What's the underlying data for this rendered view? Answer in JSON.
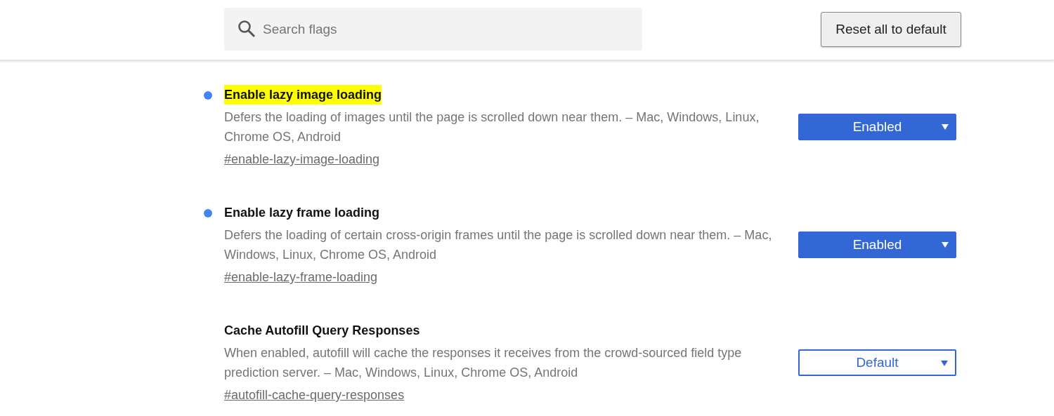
{
  "search": {
    "placeholder": "Search flags"
  },
  "reset_button": "Reset all to default",
  "experiments": [
    {
      "title": "Enable lazy image loading",
      "modified": true,
      "highlighted": true,
      "description": "Defers the loading of images until the page is scrolled down near them. – Mac, Windows, Linux, Chrome OS, Android",
      "link": "#enable-lazy-image-loading",
      "select": {
        "value": "Enabled",
        "kind": "enabled"
      }
    },
    {
      "title": "Enable lazy frame loading",
      "modified": true,
      "highlighted": false,
      "description": "Defers the loading of certain cross-origin frames until the page is scrolled down near them. – Mac, Windows, Linux, Chrome OS, Android",
      "link": "#enable-lazy-frame-loading",
      "select": {
        "value": "Enabled",
        "kind": "enabled"
      }
    },
    {
      "title": "Cache Autofill Query Responses",
      "modified": false,
      "highlighted": false,
      "description": "When enabled, autofill will cache the responses it receives from the crowd-sourced field type prediction server. – Mac, Windows, Linux, Chrome OS, Android",
      "link": "#autofill-cache-query-responses",
      "select": {
        "value": "Default",
        "kind": "default"
      }
    }
  ]
}
